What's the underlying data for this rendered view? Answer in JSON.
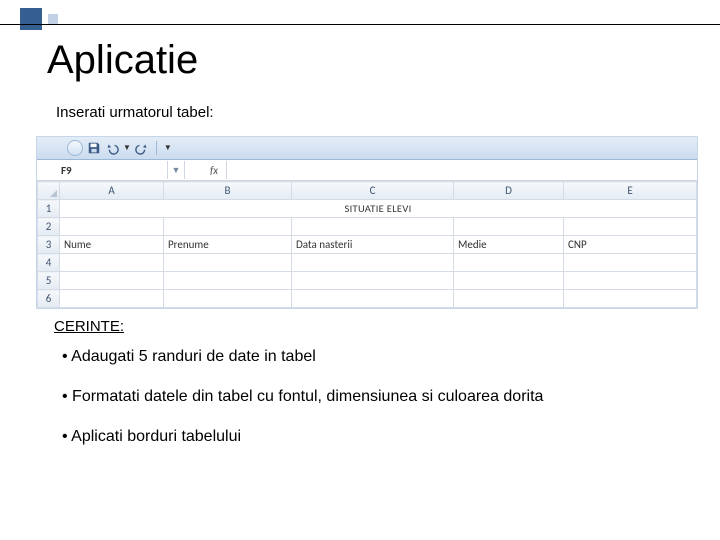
{
  "accent": {
    "big_color": "#365f91",
    "small_color": "#c3d1e6"
  },
  "title": "Aplicatie",
  "intro": "Inserati urmatorul tabel:",
  "excel": {
    "namebox": "F9",
    "col_headers": [
      "A",
      "B",
      "C",
      "D",
      "E"
    ],
    "row_headers": [
      "1",
      "2",
      "3",
      "4",
      "5",
      "6"
    ],
    "rows": {
      "r1": {
        "merged": "SITUATIE ELEVI"
      },
      "r3": [
        "Nume",
        "Prenume",
        "Data nasterii",
        "Medie",
        "CNP"
      ]
    }
  },
  "cerinte_label": "CERINTE:",
  "bullets": [
    "• Adaugati 5 randuri de date in tabel",
    "• Formatati datele din tabel cu fontul, dimensiunea si culoarea dorita",
    "• Aplicati borduri tabelului"
  ]
}
